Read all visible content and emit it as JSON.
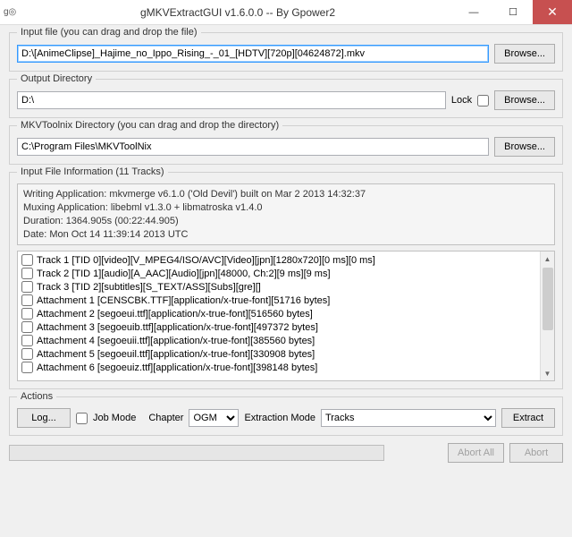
{
  "window": {
    "title": "gMKVExtractGUI v1.6.0.0 -- By Gpower2",
    "icon_text": "g◎"
  },
  "input_file": {
    "label": "Input file (you can drag and drop the file)",
    "value": "D:\\[AnimeClipse]_Hajime_no_Ippo_Rising_-_01_[HDTV][720p][04624872].mkv",
    "browse": "Browse..."
  },
  "output_dir": {
    "label": "Output Directory",
    "value": "D:\\",
    "lock_label": "Lock",
    "browse": "Browse..."
  },
  "mkvtoolnix": {
    "label": "MKVToolnix Directory (you can drag and drop the directory)",
    "value": "C:\\Program Files\\MKVToolNix",
    "browse": "Browse..."
  },
  "info": {
    "label": "Input File Information (11 Tracks)",
    "lines": [
      "Writing Application: mkvmerge v6.1.0 ('Old Devil') built on Mar  2 2013 14:32:37",
      "Muxing Application: libebml v1.3.0 + libmatroska v1.4.0",
      "Duration: 1364.905s (00:22:44.905)",
      "Date: Mon Oct 14 11:39:14 2013 UTC"
    ],
    "tracks": [
      "Track 1 [TID 0][video][V_MPEG4/ISO/AVC][Video][jpn][1280x720][0 ms][0 ms]",
      "Track 2 [TID 1][audio][A_AAC][Audio][jpn][48000, Ch:2][9 ms][9 ms]",
      "Track 3 [TID 2][subtitles][S_TEXT/ASS][Subs][gre][]",
      "Attachment 1 [CENSCBK.TTF][application/x-true-font][51716 bytes]",
      "Attachment 2 [segoeui.ttf][application/x-true-font][516560 bytes]",
      "Attachment 3 [segoeuib.ttf][application/x-true-font][497372 bytes]",
      "Attachment 4 [segoeuii.ttf][application/x-true-font][385560 bytes]",
      "Attachment 5 [segoeuil.ttf][application/x-true-font][330908 bytes]",
      "Attachment 6 [segoeuiz.ttf][application/x-true-font][398148 bytes]"
    ]
  },
  "actions": {
    "label": "Actions",
    "log": "Log...",
    "job_mode": "Job Mode",
    "chapter_label": "Chapter",
    "chapter_value": "OGM",
    "extraction_label": "Extraction Mode",
    "extraction_value": "Tracks",
    "extract": "Extract"
  },
  "bottom": {
    "abort_all": "Abort All",
    "abort": "Abort"
  }
}
